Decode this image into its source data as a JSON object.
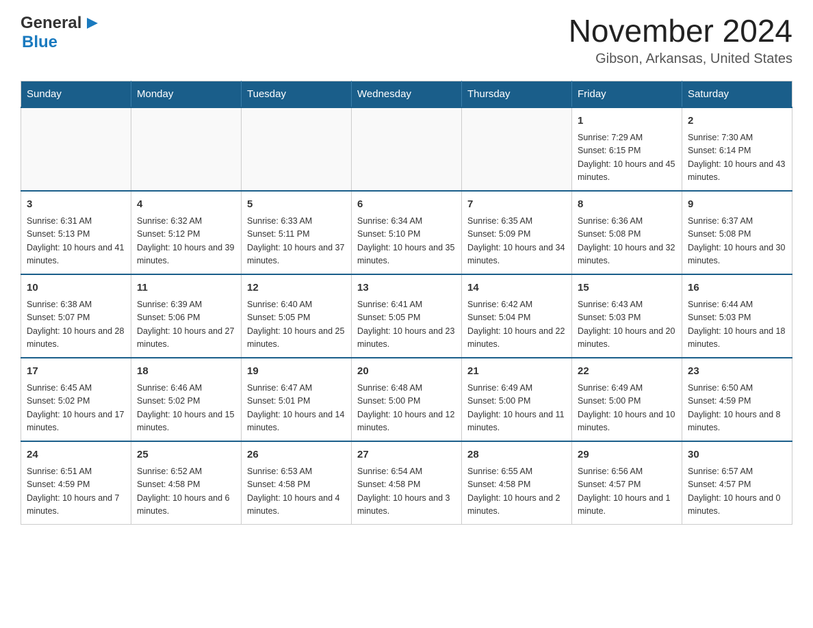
{
  "header": {
    "logo": {
      "general": "General",
      "blue": "Blue"
    },
    "title": "November 2024",
    "location": "Gibson, Arkansas, United States"
  },
  "calendar": {
    "weekdays": [
      "Sunday",
      "Monday",
      "Tuesday",
      "Wednesday",
      "Thursday",
      "Friday",
      "Saturday"
    ],
    "weeks": [
      [
        {
          "day": "",
          "sunrise": "",
          "sunset": "",
          "daylight": ""
        },
        {
          "day": "",
          "sunrise": "",
          "sunset": "",
          "daylight": ""
        },
        {
          "day": "",
          "sunrise": "",
          "sunset": "",
          "daylight": ""
        },
        {
          "day": "",
          "sunrise": "",
          "sunset": "",
          "daylight": ""
        },
        {
          "day": "",
          "sunrise": "",
          "sunset": "",
          "daylight": ""
        },
        {
          "day": "1",
          "sunrise": "Sunrise: 7:29 AM",
          "sunset": "Sunset: 6:15 PM",
          "daylight": "Daylight: 10 hours and 45 minutes."
        },
        {
          "day": "2",
          "sunrise": "Sunrise: 7:30 AM",
          "sunset": "Sunset: 6:14 PM",
          "daylight": "Daylight: 10 hours and 43 minutes."
        }
      ],
      [
        {
          "day": "3",
          "sunrise": "Sunrise: 6:31 AM",
          "sunset": "Sunset: 5:13 PM",
          "daylight": "Daylight: 10 hours and 41 minutes."
        },
        {
          "day": "4",
          "sunrise": "Sunrise: 6:32 AM",
          "sunset": "Sunset: 5:12 PM",
          "daylight": "Daylight: 10 hours and 39 minutes."
        },
        {
          "day": "5",
          "sunrise": "Sunrise: 6:33 AM",
          "sunset": "Sunset: 5:11 PM",
          "daylight": "Daylight: 10 hours and 37 minutes."
        },
        {
          "day": "6",
          "sunrise": "Sunrise: 6:34 AM",
          "sunset": "Sunset: 5:10 PM",
          "daylight": "Daylight: 10 hours and 35 minutes."
        },
        {
          "day": "7",
          "sunrise": "Sunrise: 6:35 AM",
          "sunset": "Sunset: 5:09 PM",
          "daylight": "Daylight: 10 hours and 34 minutes."
        },
        {
          "day": "8",
          "sunrise": "Sunrise: 6:36 AM",
          "sunset": "Sunset: 5:08 PM",
          "daylight": "Daylight: 10 hours and 32 minutes."
        },
        {
          "day": "9",
          "sunrise": "Sunrise: 6:37 AM",
          "sunset": "Sunset: 5:08 PM",
          "daylight": "Daylight: 10 hours and 30 minutes."
        }
      ],
      [
        {
          "day": "10",
          "sunrise": "Sunrise: 6:38 AM",
          "sunset": "Sunset: 5:07 PM",
          "daylight": "Daylight: 10 hours and 28 minutes."
        },
        {
          "day": "11",
          "sunrise": "Sunrise: 6:39 AM",
          "sunset": "Sunset: 5:06 PM",
          "daylight": "Daylight: 10 hours and 27 minutes."
        },
        {
          "day": "12",
          "sunrise": "Sunrise: 6:40 AM",
          "sunset": "Sunset: 5:05 PM",
          "daylight": "Daylight: 10 hours and 25 minutes."
        },
        {
          "day": "13",
          "sunrise": "Sunrise: 6:41 AM",
          "sunset": "Sunset: 5:05 PM",
          "daylight": "Daylight: 10 hours and 23 minutes."
        },
        {
          "day": "14",
          "sunrise": "Sunrise: 6:42 AM",
          "sunset": "Sunset: 5:04 PM",
          "daylight": "Daylight: 10 hours and 22 minutes."
        },
        {
          "day": "15",
          "sunrise": "Sunrise: 6:43 AM",
          "sunset": "Sunset: 5:03 PM",
          "daylight": "Daylight: 10 hours and 20 minutes."
        },
        {
          "day": "16",
          "sunrise": "Sunrise: 6:44 AM",
          "sunset": "Sunset: 5:03 PM",
          "daylight": "Daylight: 10 hours and 18 minutes."
        }
      ],
      [
        {
          "day": "17",
          "sunrise": "Sunrise: 6:45 AM",
          "sunset": "Sunset: 5:02 PM",
          "daylight": "Daylight: 10 hours and 17 minutes."
        },
        {
          "day": "18",
          "sunrise": "Sunrise: 6:46 AM",
          "sunset": "Sunset: 5:02 PM",
          "daylight": "Daylight: 10 hours and 15 minutes."
        },
        {
          "day": "19",
          "sunrise": "Sunrise: 6:47 AM",
          "sunset": "Sunset: 5:01 PM",
          "daylight": "Daylight: 10 hours and 14 minutes."
        },
        {
          "day": "20",
          "sunrise": "Sunrise: 6:48 AM",
          "sunset": "Sunset: 5:00 PM",
          "daylight": "Daylight: 10 hours and 12 minutes."
        },
        {
          "day": "21",
          "sunrise": "Sunrise: 6:49 AM",
          "sunset": "Sunset: 5:00 PM",
          "daylight": "Daylight: 10 hours and 11 minutes."
        },
        {
          "day": "22",
          "sunrise": "Sunrise: 6:49 AM",
          "sunset": "Sunset: 5:00 PM",
          "daylight": "Daylight: 10 hours and 10 minutes."
        },
        {
          "day": "23",
          "sunrise": "Sunrise: 6:50 AM",
          "sunset": "Sunset: 4:59 PM",
          "daylight": "Daylight: 10 hours and 8 minutes."
        }
      ],
      [
        {
          "day": "24",
          "sunrise": "Sunrise: 6:51 AM",
          "sunset": "Sunset: 4:59 PM",
          "daylight": "Daylight: 10 hours and 7 minutes."
        },
        {
          "day": "25",
          "sunrise": "Sunrise: 6:52 AM",
          "sunset": "Sunset: 4:58 PM",
          "daylight": "Daylight: 10 hours and 6 minutes."
        },
        {
          "day": "26",
          "sunrise": "Sunrise: 6:53 AM",
          "sunset": "Sunset: 4:58 PM",
          "daylight": "Daylight: 10 hours and 4 minutes."
        },
        {
          "day": "27",
          "sunrise": "Sunrise: 6:54 AM",
          "sunset": "Sunset: 4:58 PM",
          "daylight": "Daylight: 10 hours and 3 minutes."
        },
        {
          "day": "28",
          "sunrise": "Sunrise: 6:55 AM",
          "sunset": "Sunset: 4:58 PM",
          "daylight": "Daylight: 10 hours and 2 minutes."
        },
        {
          "day": "29",
          "sunrise": "Sunrise: 6:56 AM",
          "sunset": "Sunset: 4:57 PM",
          "daylight": "Daylight: 10 hours and 1 minute."
        },
        {
          "day": "30",
          "sunrise": "Sunrise: 6:57 AM",
          "sunset": "Sunset: 4:57 PM",
          "daylight": "Daylight: 10 hours and 0 minutes."
        }
      ]
    ]
  }
}
